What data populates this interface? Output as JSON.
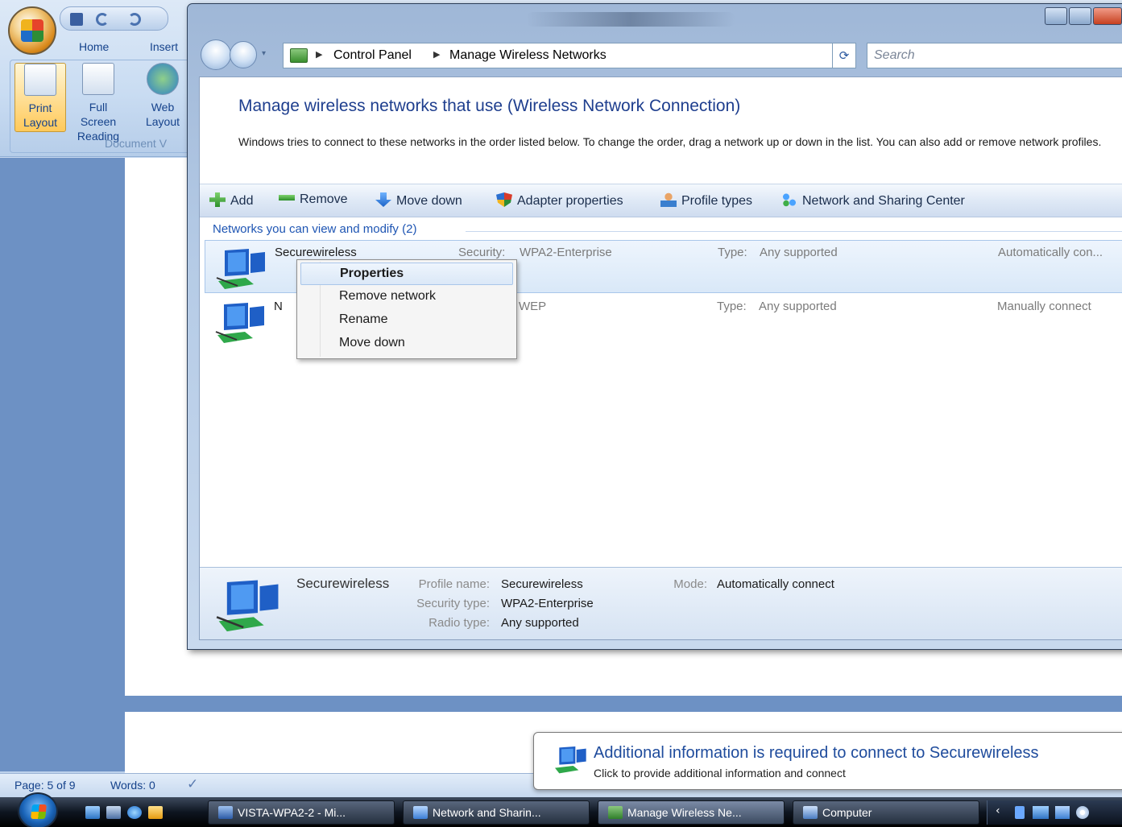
{
  "word": {
    "tabs": [
      "Home",
      "Insert"
    ],
    "ribbon_buttons": [
      {
        "label_line1": "Print",
        "label_line2": "Layout"
      },
      {
        "label_line1": "Full Screen",
        "label_line2": "Reading"
      },
      {
        "label_line1": "Web",
        "label_line2": "Layout"
      }
    ],
    "group_label": "Document V",
    "status": {
      "page": "Page: 5 of 9",
      "words": "Words: 0"
    }
  },
  "explorer": {
    "breadcrumb": [
      "Control Panel",
      "Manage Wireless Networks"
    ],
    "search_placeholder": "Search",
    "title": "Manage wireless networks that use (Wireless Network Connection)",
    "description": "Windows tries to connect to these networks in the order listed below. To change the order, drag a network up or down in the list. You can also add or remove network profiles.",
    "toolbar": {
      "add": "Add",
      "remove": "Remove",
      "move_down": "Move down",
      "adapter_properties": "Adapter properties",
      "profile_types": "Profile types",
      "network_center": "Network and Sharing Center"
    },
    "group_header": "Networks you can view and modify (2)",
    "networks": [
      {
        "name": "Securewireless",
        "security_label": "Security:",
        "security": "WPA2-Enterprise",
        "type_label": "Type:",
        "type": "Any supported",
        "mode": "Automatically con..."
      },
      {
        "name": "N",
        "security_label": ":",
        "security": "WEP",
        "type_label": "Type:",
        "type": "Any supported",
        "mode": "Manually connect"
      }
    ],
    "context_menu": [
      "Properties",
      "Remove network",
      "Rename",
      "Move down"
    ],
    "details": {
      "name": "Securewireless",
      "profile_label": "Profile name:",
      "profile": "Securewireless",
      "security_label": "Security type:",
      "security": "WPA2-Enterprise",
      "radio_label": "Radio type:",
      "radio": "Any supported",
      "mode_label": "Mode:",
      "mode": "Automatically connect"
    }
  },
  "balloon": {
    "title": "Additional information is required to connect to Securewireless",
    "text": "Click to provide additional information and connect"
  },
  "taskbar": {
    "buttons": [
      "VISTA-WPA2-2 - Mi...",
      "Network and Sharin...",
      "Manage Wireless Ne...",
      "Computer"
    ]
  },
  "colors": {
    "accent": "#1e3e8e",
    "link": "#1e55b3"
  }
}
